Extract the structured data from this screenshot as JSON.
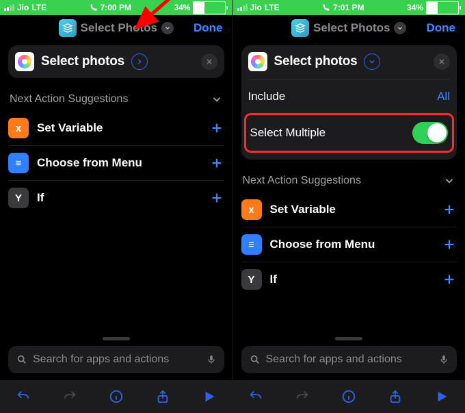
{
  "accent": "#4289ff",
  "status_left": {
    "carrier": "Jio",
    "network": "LTE",
    "time": "7:00 PM",
    "time2": "7:01 PM"
  },
  "status_right": {
    "battery_pct": "34%"
  },
  "nav": {
    "title": "Select Photos",
    "done": "Done"
  },
  "action": {
    "title": "Select photos"
  },
  "options": {
    "include_label": "Include",
    "include_value": "All",
    "select_multiple_label": "Select Multiple"
  },
  "suggestions": {
    "heading": "Next Action Suggestions",
    "items": [
      {
        "label": "Set Variable",
        "icon": "x",
        "icon_class": "ic-orange",
        "name": "set-variable"
      },
      {
        "label": "Choose from Menu",
        "icon": "≡",
        "icon_class": "ic-blue",
        "name": "choose-from-menu"
      },
      {
        "label": "If",
        "icon": "Y",
        "icon_class": "ic-gray",
        "name": "if"
      }
    ]
  },
  "search": {
    "placeholder": "Search for apps and actions"
  }
}
